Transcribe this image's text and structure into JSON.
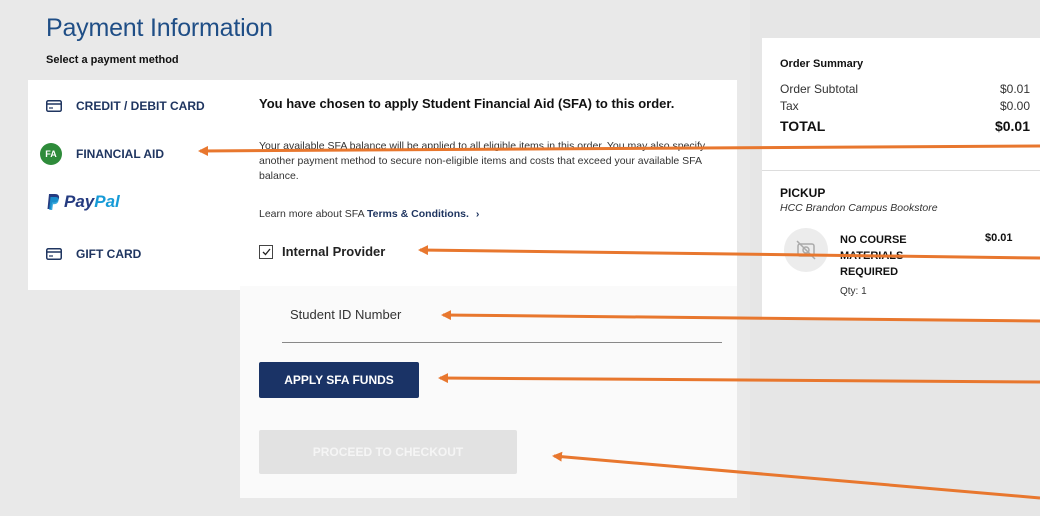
{
  "page": {
    "title": "Payment Information",
    "subtitle": "Select a payment method"
  },
  "payment_methods": [
    {
      "label": "CREDIT / DEBIT CARD",
      "icon": "credit-card-icon"
    },
    {
      "label": "FINANCIAL AID",
      "icon": "fa-badge-icon",
      "badge": "FA",
      "selected": true
    },
    {
      "label": "PayPal",
      "icon": "paypal-logo",
      "logo_parts": [
        "Pay",
        "Pal"
      ]
    },
    {
      "label": "GIFT CARD",
      "icon": "gift-card-icon"
    }
  ],
  "sfa": {
    "heading": "You have chosen to apply Student Financial Aid (SFA) to this order.",
    "description": "Your available SFA balance will be applied to all eligible items in this order. You may also specify another payment method to secure non-eligible items and costs that exceed your available SFA balance.",
    "learn_more_prefix": "Learn more about SFA",
    "learn_more_link": "Terms & Conditions.",
    "learn_more_chevron": "›",
    "provider_label": "Internal Provider",
    "provider_checked": true,
    "student_id_label": "Student ID Number",
    "student_id_value": "",
    "apply_button": "APPLY SFA FUNDS",
    "proceed_button": "PROCEED TO CHECKOUT"
  },
  "order_summary": {
    "title": "Order Summary",
    "subtotal_label": "Order Subtotal",
    "subtotal_value": "$0.01",
    "tax_label": "Tax",
    "tax_value": "$0.00",
    "total_label": "TOTAL",
    "total_value": "$0.01",
    "pickup_heading": "PICKUP",
    "pickup_location": "HCC Brandon Campus Bookstore",
    "item": {
      "name": "NO COURSE MATERIALS REQUIRED",
      "qty": "Qty: 1",
      "price": "$0.01"
    }
  },
  "colors": {
    "brand_blue": "#1f4e86",
    "button_navy": "#1a3366",
    "fa_green": "#2e8b3a",
    "annotation_orange": "#e8772e"
  }
}
